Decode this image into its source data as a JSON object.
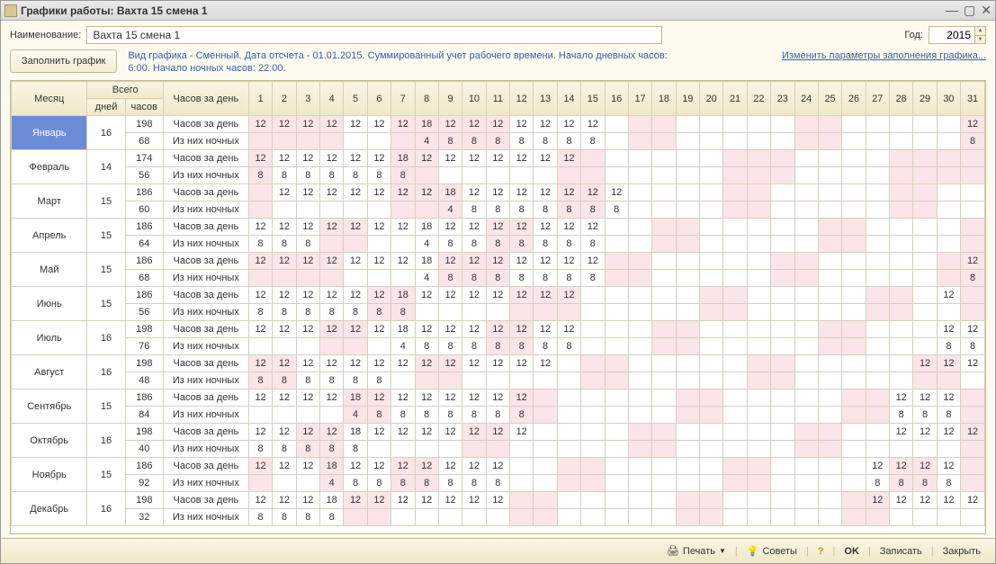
{
  "title": "Графики работы: Вахта 15 смена 1",
  "labels": {
    "name": "Наименование:",
    "year": "Год:",
    "fill": "Заполнить график",
    "month": "Месяц",
    "total": "Всего",
    "days": "дней",
    "hours": "часов",
    "hours_per_day": "Часов за день",
    "hours_row": "Часов за день",
    "night_row": "Из них ночных",
    "link": "Изменить параметры заполнения графика...",
    "print": "Печать",
    "tips": "Советы",
    "ok": "OK",
    "save": "Записать",
    "close": "Закрыть"
  },
  "name_value": "Вахта 15 смена 1",
  "year_value": "2015",
  "info_text": "Вид графика - Сменный. Дата отсчета - 01.01.2015. Суммированный учет рабочего времени. Начало дневных часов: 6:00. Начало ночных часов: 22:00.",
  "days_in_month": 31,
  "months": [
    {
      "name": "Январь",
      "selected": true,
      "totals_days": 16,
      "totals_hours": 198,
      "totals_night": 68,
      "pink": [
        1,
        2,
        3,
        4,
        7,
        8,
        9,
        10,
        11,
        17,
        18,
        24,
        25,
        31
      ],
      "hours_cells": {
        "1": 12,
        "2": 12,
        "3": 12,
        "4": 12,
        "5": 12,
        "6": 12,
        "7": 12,
        "8": 18,
        "9": 12,
        "10": 12,
        "11": 12,
        "12": 12,
        "13": 12,
        "14": 12,
        "15": 12,
        "31": 12
      },
      "night_cells": {
        "8": 4,
        "9": 8,
        "10": 8,
        "11": 8,
        "12": 8,
        "13": 8,
        "14": 8,
        "15": 8,
        "31": 8
      }
    },
    {
      "name": "Февраль",
      "totals_days": 14,
      "totals_hours": 174,
      "totals_night": 56,
      "pink": [
        1,
        7,
        8,
        14,
        15,
        21,
        22,
        23,
        28,
        29,
        30,
        31
      ],
      "hours_cells": {
        "1": 12,
        "2": 12,
        "3": 12,
        "4": 12,
        "5": 12,
        "6": 12,
        "7": 18,
        "8": 12,
        "9": 12,
        "10": 12,
        "11": 12,
        "12": 12,
        "13": 12,
        "14": 12
      },
      "night_cells": {
        "1": 8,
        "2": 8,
        "3": 8,
        "4": 8,
        "5": 8,
        "6": 8,
        "7": 8
      }
    },
    {
      "name": "Март",
      "totals_days": 15,
      "totals_hours": 186,
      "totals_night": 60,
      "pink": [
        1,
        7,
        8,
        9,
        14,
        15,
        21,
        22,
        28,
        29
      ],
      "hours_cells": {
        "2": 12,
        "3": 12,
        "4": 12,
        "5": 12,
        "6": 12,
        "7": 12,
        "8": 12,
        "9": 18,
        "10": 12,
        "11": 12,
        "12": 12,
        "13": 12,
        "14": 12,
        "15": 12,
        "16": 12
      },
      "night_cells": {
        "9": 4,
        "10": 8,
        "11": 8,
        "12": 8,
        "13": 8,
        "14": 8,
        "15": 8,
        "16": 8
      }
    },
    {
      "name": "Апрель",
      "totals_days": 15,
      "totals_hours": 186,
      "totals_night": 64,
      "pink": [
        4,
        5,
        11,
        12,
        18,
        19,
        25,
        26,
        31
      ],
      "hours_cells": {
        "1": 12,
        "2": 12,
        "3": 12,
        "4": 12,
        "5": 12,
        "6": 12,
        "7": 12,
        "8": 18,
        "9": 12,
        "10": 12,
        "11": 12,
        "12": 12,
        "13": 12,
        "14": 12,
        "15": 12
      },
      "night_cells": {
        "1": 8,
        "2": 8,
        "3": 8,
        "8": 4,
        "9": 8,
        "10": 8,
        "11": 8,
        "12": 8,
        "13": 8,
        "14": 8,
        "15": 8
      }
    },
    {
      "name": "Май",
      "totals_days": 15,
      "totals_hours": 186,
      "totals_night": 68,
      "pink": [
        1,
        2,
        3,
        4,
        9,
        10,
        11,
        16,
        17,
        23,
        24,
        30,
        31
      ],
      "hours_cells": {
        "1": 12,
        "2": 12,
        "3": 12,
        "4": 12,
        "5": 12,
        "6": 12,
        "7": 12,
        "8": 18,
        "9": 12,
        "10": 12,
        "11": 12,
        "12": 12,
        "13": 12,
        "14": 12,
        "15": 12,
        "31": 12
      },
      "night_cells": {
        "8": 4,
        "9": 8,
        "10": 8,
        "11": 8,
        "12": 8,
        "13": 8,
        "14": 8,
        "15": 8,
        "31": 8
      }
    },
    {
      "name": "Июнь",
      "totals_days": 15,
      "totals_hours": 186,
      "totals_night": 56,
      "pink": [
        6,
        7,
        12,
        13,
        14,
        20,
        21,
        27,
        28,
        31
      ],
      "hours_cells": {
        "1": 12,
        "2": 12,
        "3": 12,
        "4": 12,
        "5": 12,
        "6": 12,
        "7": 18,
        "8": 12,
        "9": 12,
        "10": 12,
        "11": 12,
        "12": 12,
        "13": 12,
        "14": 12,
        "30": 12
      },
      "night_cells": {
        "1": 8,
        "2": 8,
        "3": 8,
        "4": 8,
        "5": 8,
        "6": 8,
        "7": 8
      }
    },
    {
      "name": "Июль",
      "totals_days": 16,
      "totals_hours": 198,
      "totals_night": 76,
      "pink": [
        4,
        5,
        11,
        12,
        18,
        19,
        25,
        26
      ],
      "hours_cells": {
        "1": 12,
        "2": 12,
        "3": 12,
        "4": 12,
        "5": 12,
        "6": 12,
        "7": 18,
        "8": 12,
        "9": 12,
        "10": 12,
        "11": 12,
        "12": 12,
        "13": 12,
        "14": 12,
        "30": 12,
        "31": 12
      },
      "night_cells": {
        "7": 4,
        "8": 8,
        "9": 8,
        "10": 8,
        "11": 8,
        "12": 8,
        "13": 8,
        "14": 8,
        "30": 8,
        "31": 8
      }
    },
    {
      "name": "Август",
      "totals_days": 16,
      "totals_hours": 198,
      "totals_night": 48,
      "pink": [
        1,
        2,
        8,
        9,
        15,
        16,
        22,
        23,
        29,
        30
      ],
      "hours_cells": {
        "1": 12,
        "2": 12,
        "3": 12,
        "4": 12,
        "5": 12,
        "6": 12,
        "7": 12,
        "8": 12,
        "9": 12,
        "10": 12,
        "11": 12,
        "12": 12,
        "13": 12,
        "29": 12,
        "30": 12,
        "31": 12
      },
      "night_cells": {
        "1": 8,
        "2": 8,
        "3": 8,
        "4": 8,
        "5": 8,
        "6": 8
      }
    },
    {
      "name": "Сентябрь",
      "totals_days": 15,
      "totals_hours": 186,
      "totals_night": 84,
      "pink": [
        5,
        6,
        12,
        13,
        19,
        20,
        26,
        27,
        31
      ],
      "hours_cells": {
        "1": 12,
        "2": 12,
        "3": 12,
        "4": 12,
        "5": 18,
        "6": 12,
        "7": 12,
        "8": 12,
        "9": 12,
        "10": 12,
        "11": 12,
        "12": 12,
        "28": 12,
        "29": 12,
        "30": 12
      },
      "night_cells": {
        "5": 4,
        "6": 8,
        "7": 8,
        "8": 8,
        "9": 8,
        "10": 8,
        "11": 8,
        "12": 8,
        "28": 8,
        "29": 8,
        "30": 8
      }
    },
    {
      "name": "Октябрь",
      "totals_days": 16,
      "totals_hours": 198,
      "totals_night": 40,
      "pink": [
        3,
        4,
        10,
        11,
        17,
        18,
        24,
        25,
        31
      ],
      "hours_cells": {
        "1": 12,
        "2": 12,
        "3": 12,
        "4": 12,
        "5": 18,
        "6": 12,
        "7": 12,
        "8": 12,
        "9": 12,
        "10": 12,
        "11": 12,
        "12": 12,
        "28": 12,
        "29": 12,
        "30": 12,
        "31": 12
      },
      "night_cells": {
        "1": 8,
        "2": 8,
        "3": 8,
        "4": 8,
        "5": 8
      }
    },
    {
      "name": "Ноябрь",
      "totals_days": 15,
      "totals_hours": 186,
      "totals_night": 92,
      "pink": [
        1,
        4,
        7,
        8,
        14,
        15,
        21,
        22,
        28,
        29,
        31
      ],
      "hours_cells": {
        "1": 12,
        "2": 12,
        "3": 12,
        "4": 18,
        "5": 12,
        "6": 12,
        "7": 12,
        "8": 12,
        "9": 12,
        "10": 12,
        "11": 12,
        "27": 12,
        "28": 12,
        "29": 12,
        "30": 12
      },
      "night_cells": {
        "4": 4,
        "5": 8,
        "6": 8,
        "7": 8,
        "8": 8,
        "9": 8,
        "10": 8,
        "11": 8,
        "27": 8,
        "28": 8,
        "29": 8,
        "30": 8
      }
    },
    {
      "name": "Декабрь",
      "totals_days": 16,
      "totals_hours": 198,
      "totals_night": 32,
      "pink": [
        5,
        6,
        12,
        13,
        19,
        20,
        26,
        27
      ],
      "hours_cells": {
        "1": 12,
        "2": 12,
        "3": 12,
        "4": 18,
        "5": 12,
        "6": 12,
        "7": 12,
        "8": 12,
        "9": 12,
        "10": 12,
        "11": 12,
        "27": 12,
        "28": 12,
        "29": 12,
        "30": 12,
        "31": 12
      },
      "night_cells": {
        "1": 8,
        "2": 8,
        "3": 8,
        "4": 8
      }
    }
  ]
}
